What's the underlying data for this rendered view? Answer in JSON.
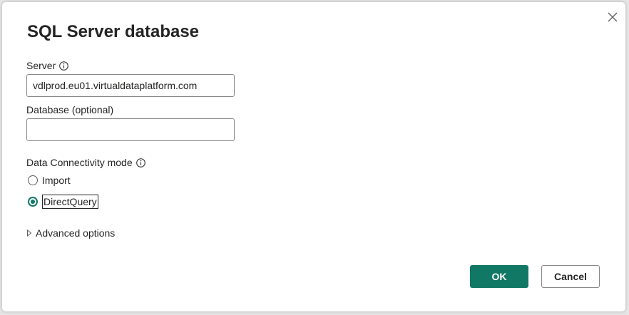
{
  "dialog": {
    "title": "SQL Server database",
    "close_icon": "close-icon"
  },
  "server": {
    "label": "Server",
    "info_icon": "info-icon",
    "value": "vdlprod.eu01.virtualdataplatform.com"
  },
  "database": {
    "label": "Database (optional)",
    "value": ""
  },
  "connectivity": {
    "label": "Data Connectivity mode",
    "info_icon": "info-icon",
    "options": [
      {
        "label": "Import",
        "selected": false
      },
      {
        "label": "DirectQuery",
        "selected": true
      }
    ]
  },
  "advanced": {
    "label": "Advanced options",
    "icon": "chevron-right-icon"
  },
  "buttons": {
    "ok_label": "OK",
    "cancel_label": "Cancel"
  },
  "colors": {
    "accent": "#117865",
    "text": "#252423",
    "border": "#8a8886"
  }
}
